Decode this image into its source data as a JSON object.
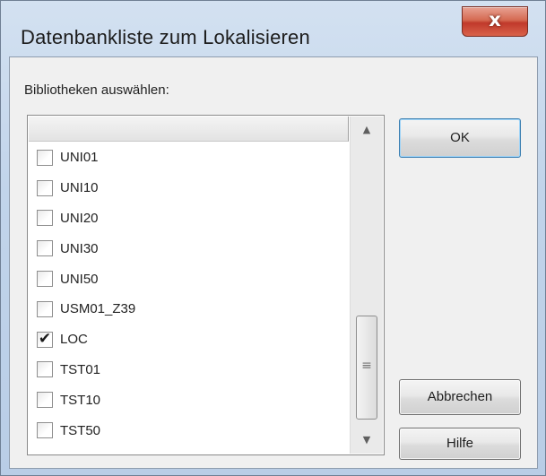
{
  "window": {
    "title": "Datenbankliste zum Lokalisieren",
    "close_glyph": "x"
  },
  "prompt": "Bibliotheken auswählen:",
  "list": {
    "items": [
      {
        "label": "UNI01",
        "checked": false
      },
      {
        "label": "UNI10",
        "checked": false
      },
      {
        "label": "UNI20",
        "checked": false
      },
      {
        "label": "UNI30",
        "checked": false
      },
      {
        "label": "UNI50",
        "checked": false
      },
      {
        "label": "USM01_Z39",
        "checked": false
      },
      {
        "label": "LOC",
        "checked": true
      },
      {
        "label": "TST01",
        "checked": false
      },
      {
        "label": "TST10",
        "checked": false
      },
      {
        "label": "TST50",
        "checked": false
      }
    ]
  },
  "buttons": {
    "ok": "OK",
    "cancel": "Abbrechen",
    "help": "Hilfe"
  },
  "colors": {
    "frame": "#c1d4ea",
    "close_button": "#c0392b",
    "client": "#f0f0f0",
    "default_button_border": "#3c7fb1"
  },
  "icons": {
    "close": "close-icon",
    "check": "checkmark-icon",
    "scroll_up": "scroll-up-arrow-icon",
    "scroll_down": "scroll-down-arrow-icon",
    "grip": "scrollbar-grip-icon"
  }
}
